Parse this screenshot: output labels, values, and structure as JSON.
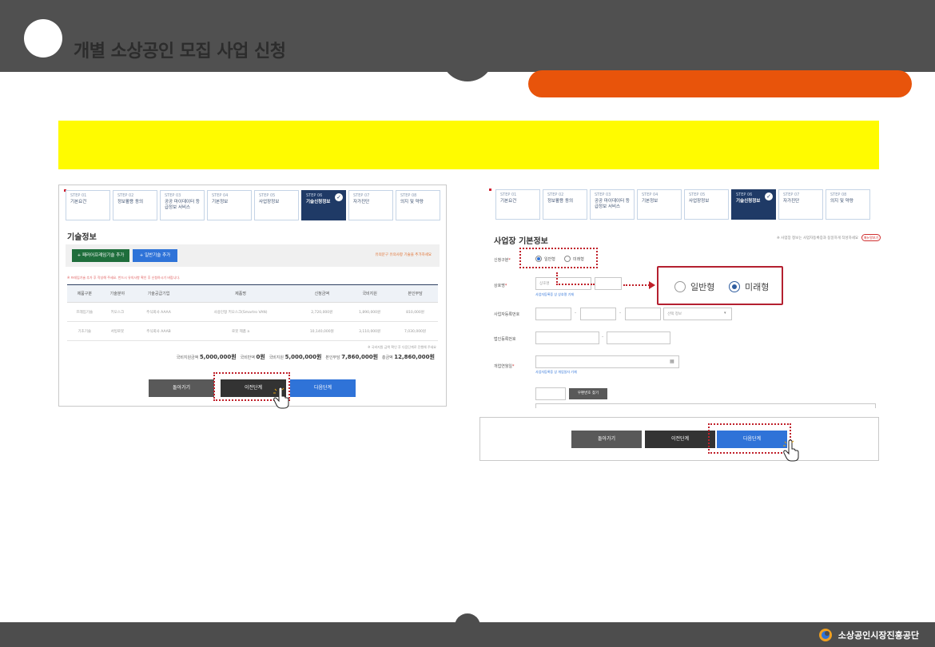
{
  "header": {
    "title": "개별 소상공인 모집 사업 신청"
  },
  "footer": {
    "org_name": "소상공인시장진흥공단"
  },
  "steps": [
    {
      "num": "STEP 01",
      "name": "기본요건"
    },
    {
      "num": "STEP 02",
      "name": "정보활용 동의"
    },
    {
      "num": "STEP 03",
      "name": "공공 마이데이터 등급정보 서비스"
    },
    {
      "num": "STEP 04",
      "name": "기본정보"
    },
    {
      "num": "STEP 05",
      "name": "사업장정보"
    },
    {
      "num": "STEP 06",
      "name": "기술신청정보"
    },
    {
      "num": "STEP 07",
      "name": "자가진단"
    },
    {
      "num": "STEP 08",
      "name": "의지 및 약량"
    }
  ],
  "left": {
    "section_title": "기술정보",
    "add_premium_label": "+ 패러어프레임기술 추가",
    "add_general_label": "+ 일반기술 추가",
    "tech_note": "유의문구 유의사항 기술을 추가하세요",
    "red_note": "※ 프레임기술 추가 후 작성해 주세요. 반드시 유의사항 확인 후 신청하시기 바랍니다.",
    "table": {
      "headers": [
        "제품구분",
        "기술분야",
        "기술공급기업",
        "제품명",
        "신청금액",
        "국비지원",
        "본인부담"
      ],
      "rows": [
        [
          "프레임기술",
          "키오스크",
          "주식회사 AAAA",
          "사용인형 키오스크(Smartro VAN)",
          "2,720,000원",
          "1,890,000원",
          "810,000원"
        ],
        [
          "기초기술",
          "서빙로봇",
          "주식회사 AAAB",
          "로봇 제품 a",
          "10,140,000원",
          "3,110,000원",
          "7,030,000원"
        ]
      ]
    },
    "sum_note": "※ 국비지원 금액 확인 후 다음단계로 진행해 주세요",
    "sum": {
      "l1": "국비지원금액",
      "v1": "5,000,000원",
      "l2": "국비반액",
      "v2": "0원",
      "l3": "국비지원",
      "v3": "5,000,000원",
      "l4": "본인부담",
      "v4": "7,860,000원",
      "l5": "총금액",
      "v5": "12,860,000원"
    },
    "btn_back": "돌아가기",
    "btn_prev": "이전단계",
    "btn_next": "다음단계"
  },
  "right": {
    "section_title": "사업장 기본정보",
    "help_note": "※ 사업장 정보는 사업자등록증과 동일하게 작성하세요",
    "help_badge": "매뉴얼보기",
    "labels": {
      "apply_type": "신청구분",
      "store_name": "상호명",
      "biz_reg_no": "사업자등록번호",
      "corp_reg_no": "법인등록번호",
      "open_date": "개업연월일"
    },
    "type_general": "일반형",
    "type_future": "미래형",
    "store_placeholder": "상호명",
    "store_hint": "사업자등록증 상 상호명 기재",
    "biz_select": "선택 정보",
    "date_hint": "사업자등록증 상 개업일자 기재",
    "zip_btn": "우편번호 찾기",
    "zoom_general": "일반형",
    "zoom_future": "미래형"
  },
  "bottom": {
    "btn_back": "돌아가기",
    "btn_prev": "이전단계",
    "btn_next": "다음단계"
  },
  "colors": {
    "orange": "#e8540b",
    "yellow": "#fffb00",
    "navy": "#1f3a66",
    "blue": "#2f73d8",
    "red": "#c0202a"
  }
}
